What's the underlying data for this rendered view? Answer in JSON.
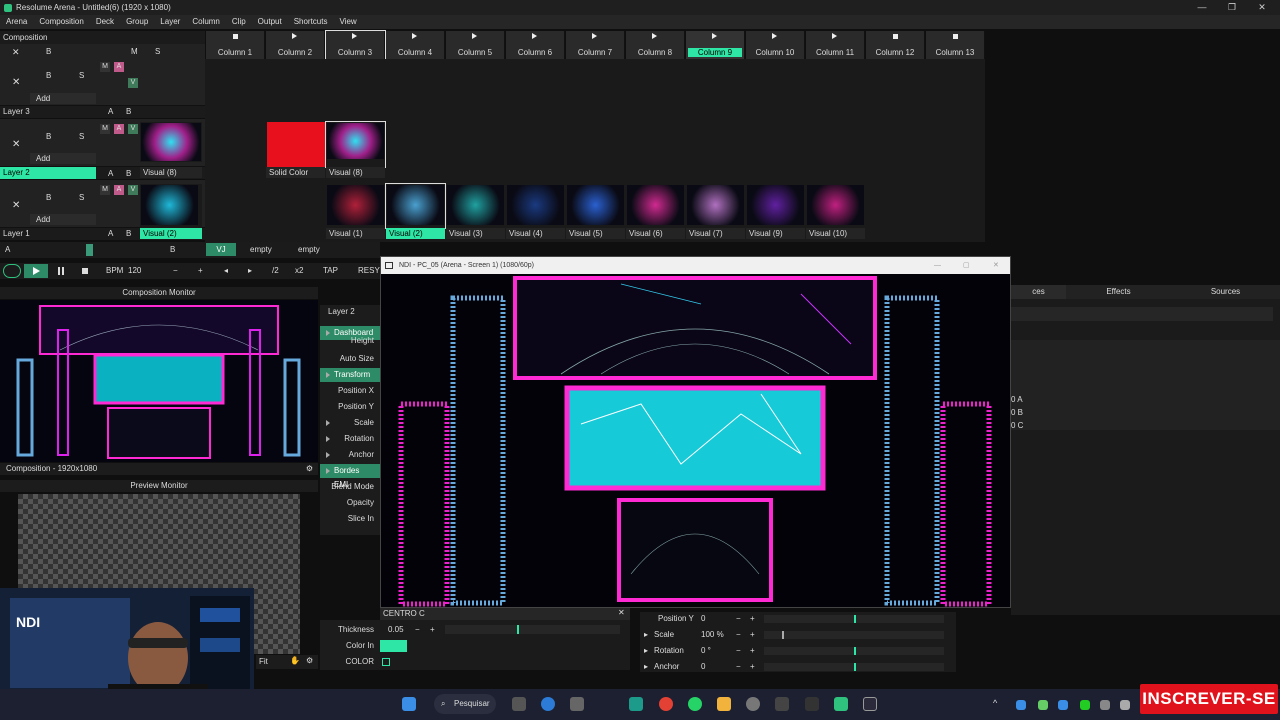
{
  "window": {
    "title": "Resolume Arena - Untitled(6) (1920 x 1080)",
    "controls": [
      "—",
      "❐",
      "✕"
    ]
  },
  "menu": [
    "Arena",
    "Composition",
    "Deck",
    "Group",
    "Layer",
    "Column",
    "Clip",
    "Output",
    "Shortcuts",
    "View"
  ],
  "composition": {
    "label": "Composition",
    "header_b": "B",
    "header_m": "M",
    "header_s": "S"
  },
  "columns": [
    "Column 1",
    "Column 2",
    "Column 3",
    "Column 4",
    "Column 5",
    "Column 6",
    "Column 7",
    "Column 8",
    "Column 9",
    "Column 10",
    "Column 11",
    "Column 12",
    "Column 13"
  ],
  "layers": [
    {
      "name": "Layer 3",
      "add": "Add"
    },
    {
      "name": "Layer 2",
      "add": "Add"
    },
    {
      "name": "Layer 1",
      "add": "Add"
    }
  ],
  "layer_ctl": {
    "x": "✕",
    "b": "B",
    "s": "S",
    "m": "M",
    "a": "A",
    "v": "V",
    "ab_a": "A",
    "ab_b": "B"
  },
  "layer2_clips": [
    "Visual (8)",
    "Solid Color",
    "Visual (8)"
  ],
  "layer1_clips": [
    "Visual (2)",
    "Visual (1)",
    "Visual (2)",
    "Visual (3)",
    "Visual (4)",
    "Visual (5)",
    "Visual (6)",
    "Visual (7)",
    "Visual (9)",
    "Visual (10)"
  ],
  "deck_bar": {
    "a": "A",
    "b": "B",
    "vj": "VJ",
    "empty1": "empty",
    "empty2": "empty"
  },
  "transport": {
    "bpm_label": "BPM",
    "bpm": "120",
    "minus": "−",
    "plus": "+",
    "half": "/2",
    "double": "x2",
    "tap": "TAP",
    "resync": "RESY"
  },
  "composition_monitor": {
    "title": "Composition Monitor",
    "resolution": "Composition - 1920x1080"
  },
  "preview_monitor": {
    "title": "Preview Monitor",
    "fit": "Fit"
  },
  "layer_panel": {
    "title": "Layer 2",
    "props": [
      "Dashboard",
      "Height",
      "Auto Size",
      "Transform",
      "Position X",
      "Position Y",
      "Scale",
      "Rotation",
      "Anchor",
      "Bordes EMI",
      "Blend Mode",
      "Opacity",
      "Slice In"
    ]
  },
  "ndi_window": {
    "title": "NDI - PC_05 (Arena - Screen 1) (1080/60p)"
  },
  "right_tabs": [
    "ces",
    "Effects",
    "Sources"
  ],
  "right_items": [
    "0 A",
    "0 B",
    "0 C"
  ],
  "effect_panel": {
    "title": "CENTRO C",
    "thickness_label": "Thickness",
    "thickness": "0.05",
    "color_in_label": "Color In",
    "color_label": "COLOR",
    "color_in": "#2ee6a6"
  },
  "transform_panel": {
    "rows": [
      {
        "label": "Position Y",
        "value": "0"
      },
      {
        "label": "Scale",
        "value": "100 %"
      },
      {
        "label": "Rotation",
        "value": "0 °"
      },
      {
        "label": "Anchor",
        "value": "0"
      }
    ]
  },
  "taskbar": {
    "search": "Pesquisar"
  },
  "subscribe": "INSCREVER-SE",
  "colors": {
    "accent": "#2ee6a6",
    "solid": "#e8101c",
    "subscribe": "#e0121b"
  },
  "webcam_label": "NDI"
}
